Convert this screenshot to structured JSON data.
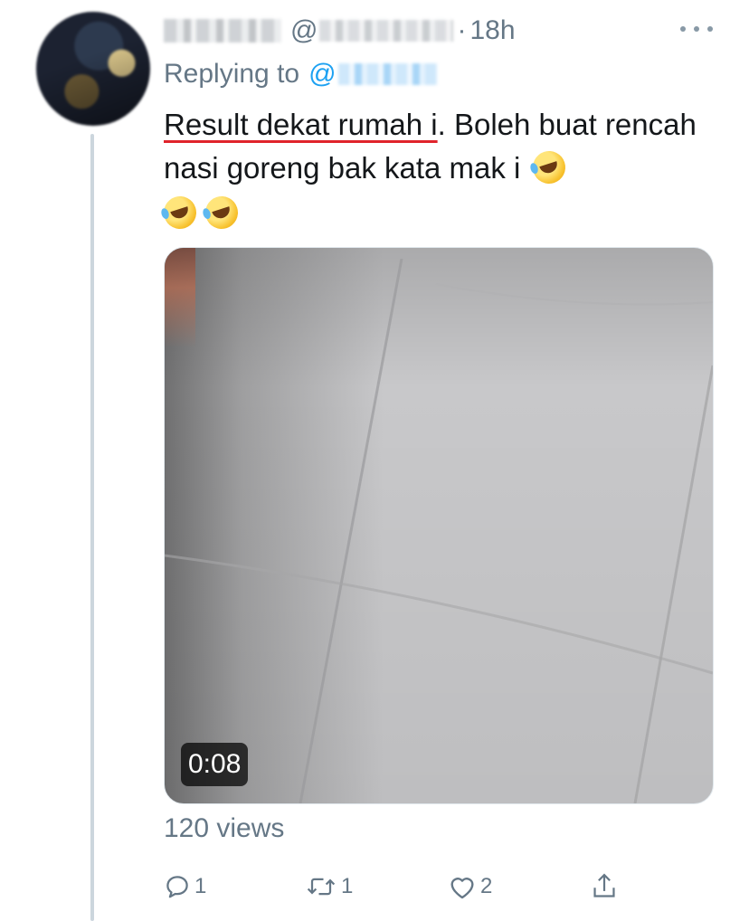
{
  "tweet": {
    "handle_at": "@",
    "separator": "·",
    "time": "18h",
    "replying_prefix": "Replying to",
    "reply_at": "@",
    "text_underlined": "Result dekat rumah i",
    "text_rest": ". Boleh buat rencah nasi goreng bak kata mak i",
    "emoji": [
      "rolling-on-floor-laughing",
      "rolling-on-floor-laughing",
      "rolling-on-floor-laughing"
    ]
  },
  "media": {
    "type": "video",
    "duration": "0:08"
  },
  "stats": {
    "views": "120 views"
  },
  "actions": {
    "reply_count": "1",
    "retweet_count": "1",
    "like_count": "2"
  },
  "colors": {
    "text": "#14171a",
    "secondary": "#657786",
    "link": "#1da1f2",
    "underline": "#e0242b"
  }
}
